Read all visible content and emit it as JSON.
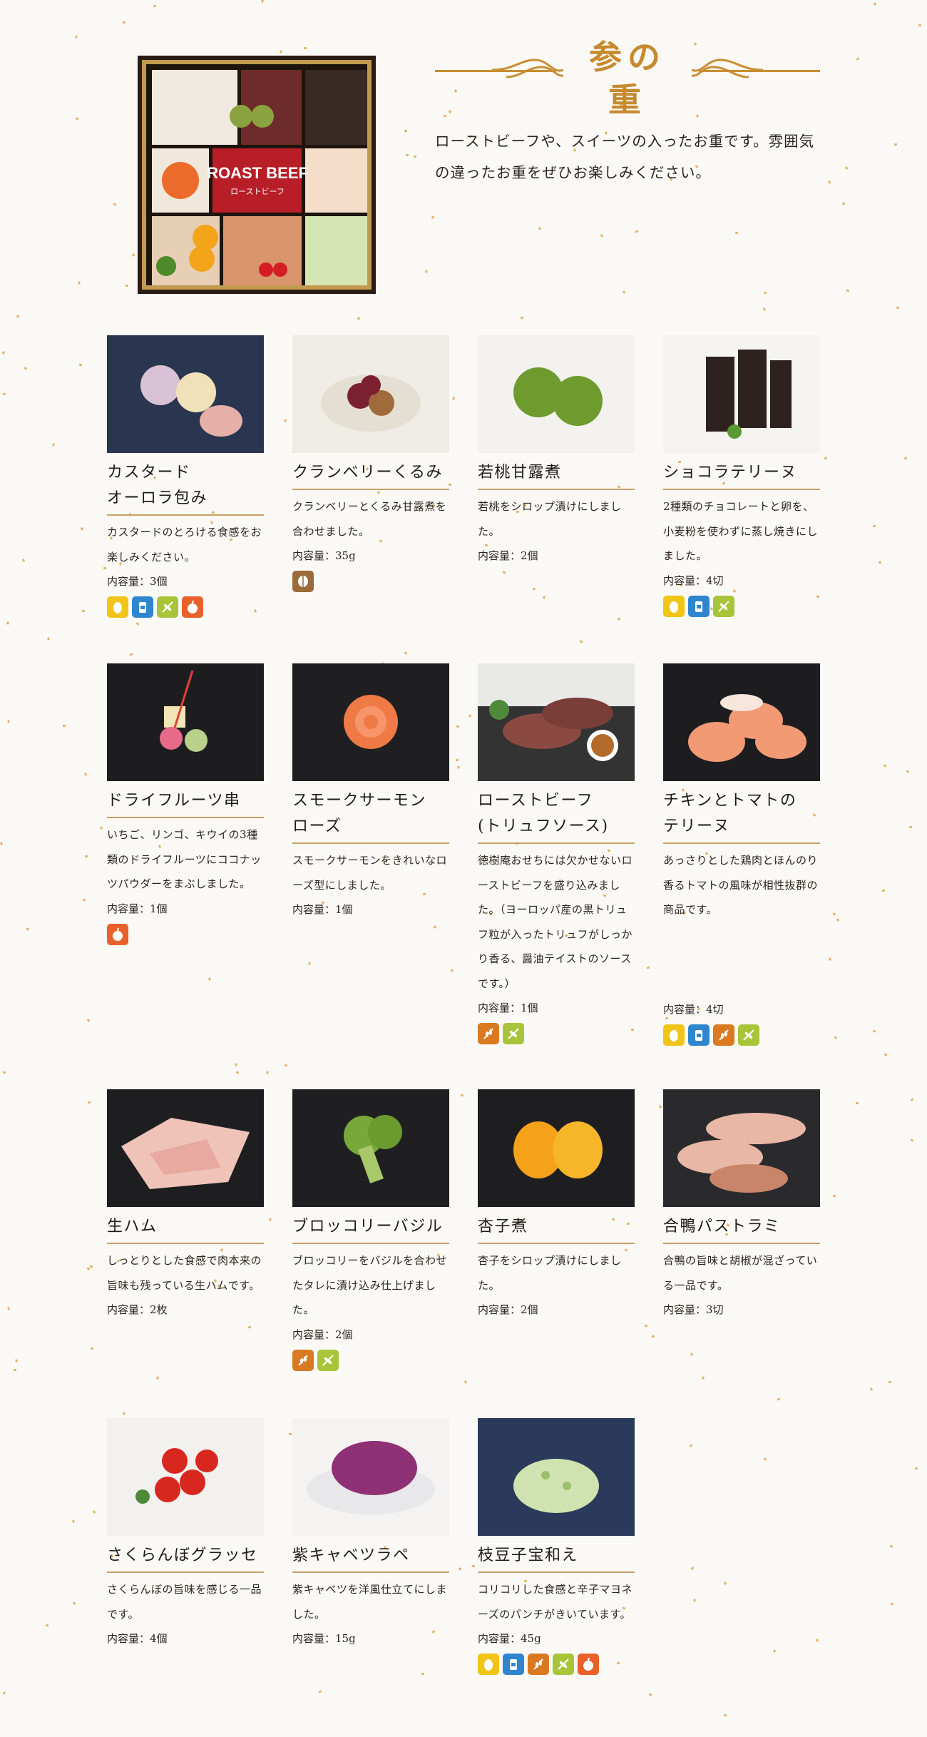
{
  "header": {
    "title": "参の重",
    "intro": "ローストビーフや、スイーツの入ったお重です。雰囲気の違ったお重をぜひお楽しみください。",
    "photo_label": "ROAST BEEF",
    "photo_sub": "ローストビーフ"
  },
  "items": [
    {
      "name": "カスタード\nオーロラ包み",
      "desc": "カスタードのとろける食感をお楽しみください。",
      "qty": "内容量：3個",
      "allergens": [
        "egg",
        "milk",
        "wheat",
        "apple"
      ]
    },
    {
      "name": "クランベリーくるみ",
      "desc": "クランベリーとくるみ甘露煮を合わせました。",
      "qty": "内容量：35g",
      "allergens": [
        "walnut"
      ]
    },
    {
      "name": "若桃甘露煮",
      "desc": "若桃をシロップ漬けにしました。",
      "qty": "内容量：2個",
      "allergens": []
    },
    {
      "name": "ショコラテリーヌ",
      "desc": "2種類のチョコレートと卵を、小麦粉を使わずに蒸し焼きにしました。",
      "qty": "内容量：4切",
      "allergens": [
        "egg",
        "milk",
        "wheat"
      ]
    },
    {
      "name": "ドライフルーツ串",
      "desc": "いちご、リンゴ、キウイの3種類のドライフルーツにココナッツパウダーをまぶしました。",
      "qty": "内容量：1個",
      "allergens": [
        "apple"
      ]
    },
    {
      "name": "スモークサーモン\nローズ",
      "desc": "スモークサーモンをきれいなローズ型にしました。",
      "qty": "内容量：1個",
      "allergens": []
    },
    {
      "name": "ローストビーフ\n(トリュフソース)",
      "desc": "徳樹庵おせちには欠かせないローストビーフを盛り込みました。（ヨーロッパ産の黒トリュフ粒が入ったトリュフがしっかり香る、醤油テイストのソースです。）",
      "qty": "内容量：1個",
      "allergens": [
        "soy",
        "wheat"
      ]
    },
    {
      "name": "チキンとトマトの\nテリーヌ",
      "desc": "あっさりとした鶏肉とほんのり香るトマトの風味が相性抜群の商品です。",
      "qty": "内容量：4切",
      "allergens": [
        "egg",
        "milk",
        "soy",
        "wheat"
      ]
    },
    {
      "name": "生ハム",
      "desc": "しっとりとした食感で肉本来の旨味も残っている生ハムです。",
      "qty": "内容量：2枚",
      "allergens": []
    },
    {
      "name": "ブロッコリーバジル",
      "desc": "ブロッコリーをバジルを合わせたタレに漬け込み仕上げました。",
      "qty": "内容量：2個",
      "allergens": [
        "soy",
        "wheat"
      ]
    },
    {
      "name": "杏子煮",
      "desc": "杏子をシロップ漬けにしました。",
      "qty": "内容量：2個",
      "allergens": []
    },
    {
      "name": "合鴨パストラミ",
      "desc": "合鴨の旨味と胡椒が混ざっている一品です。",
      "qty": "内容量：3切",
      "allergens": []
    },
    {
      "name": "さくらんぼグラッセ",
      "desc": "さくらんぼの旨味を感じる一品です。",
      "qty": "内容量：4個",
      "allergens": []
    },
    {
      "name": "紫キャベツラペ",
      "desc": "紫キャベツを洋風仕立てにしました。",
      "qty": "内容量：15g",
      "allergens": []
    },
    {
      "name": "枝豆子宝和え",
      "desc": "コリコリした食感と辛子マヨネーズのパンチがきいています。",
      "qty": "内容量：45g",
      "allergens": [
        "egg",
        "milk",
        "soy",
        "wheat",
        "apple"
      ]
    }
  ],
  "colors": {
    "accent": "#c68a2e",
    "egg": "#f1c418",
    "milk": "#2f86cf",
    "wheat": "#a8c53a",
    "apple": "#e8602a",
    "walnut": "#9b6b3a",
    "soy": "#d97a22"
  }
}
